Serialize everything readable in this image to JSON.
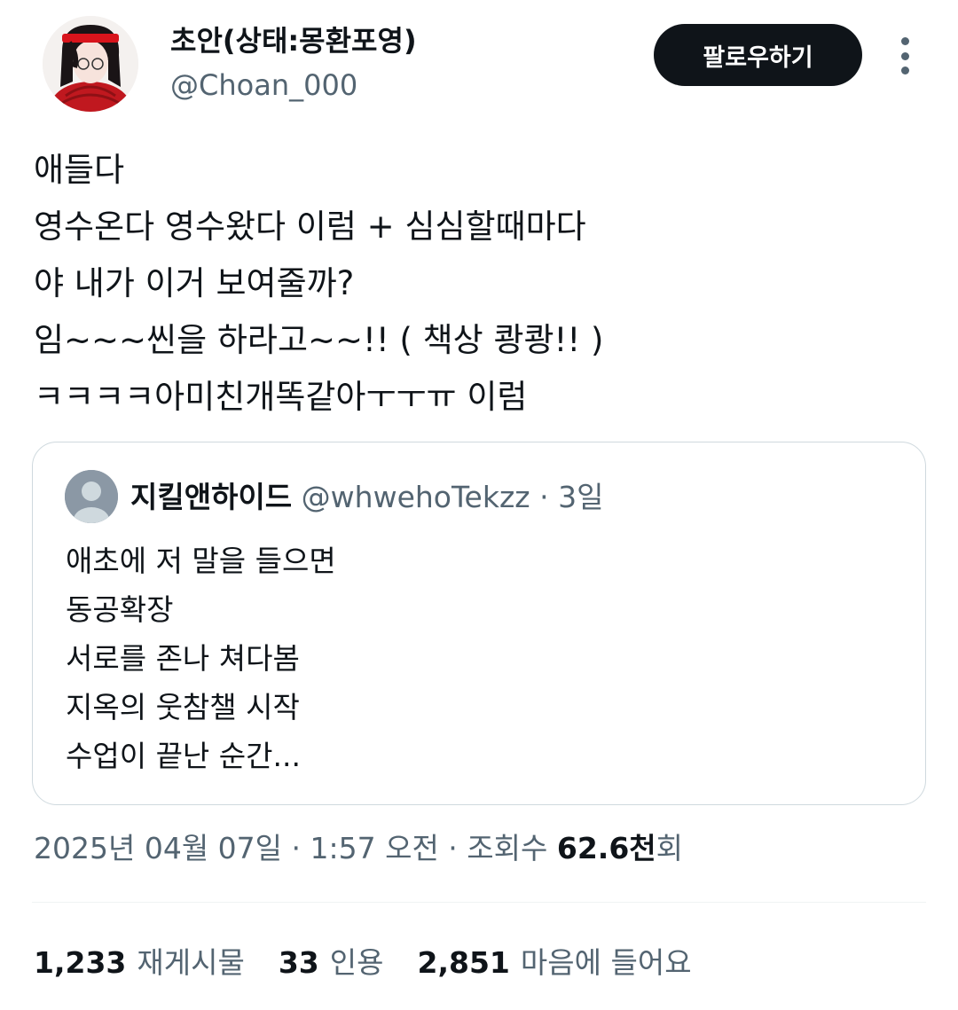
{
  "author": {
    "display_name": "초안(상태:몽환포영)",
    "handle": "@Choan_000"
  },
  "follow_button_label": "팔로우하기",
  "more_icon": "more-vertical-icon",
  "tweet": {
    "text": "애들다\n영수온다 영수왔다 이럼 + 심심할때마다\n야 내가 이거 보여줄까?\n임~~~씬을 하라고~~!! ( 책상 쾅쾅!! )\nㅋㅋㅋㅋ아미친개똑같아ㅜㅜㅠ 이럼"
  },
  "quoted_tweet": {
    "display_name": "지킬앤하이드",
    "handle": "@whwehoTekzz",
    "separator": "·",
    "time": "3일",
    "text": "애초에 저 말을 들으면\n동공확장\n서로를 존나 쳐다봄\n지옥의 웃참챌 시작\n수업이 끝난 순간..."
  },
  "meta": {
    "date_time": "2025년 04월 07일 · 1:57 오전 · 조회수 ",
    "views_number": "62.6천",
    "views_suffix": "회"
  },
  "stats": {
    "retweets_count": "1,233",
    "retweets_label": "재게시물",
    "quotes_count": "33",
    "quotes_label": "인용",
    "likes_count": "2,851",
    "likes_label": "마음에 들어요"
  },
  "colors": {
    "text_primary": "#0f1419",
    "text_secondary": "#536471",
    "border": "#cfd9de",
    "follow_button_bg": "#0f1419",
    "avatar_accent": "#c0181f"
  }
}
